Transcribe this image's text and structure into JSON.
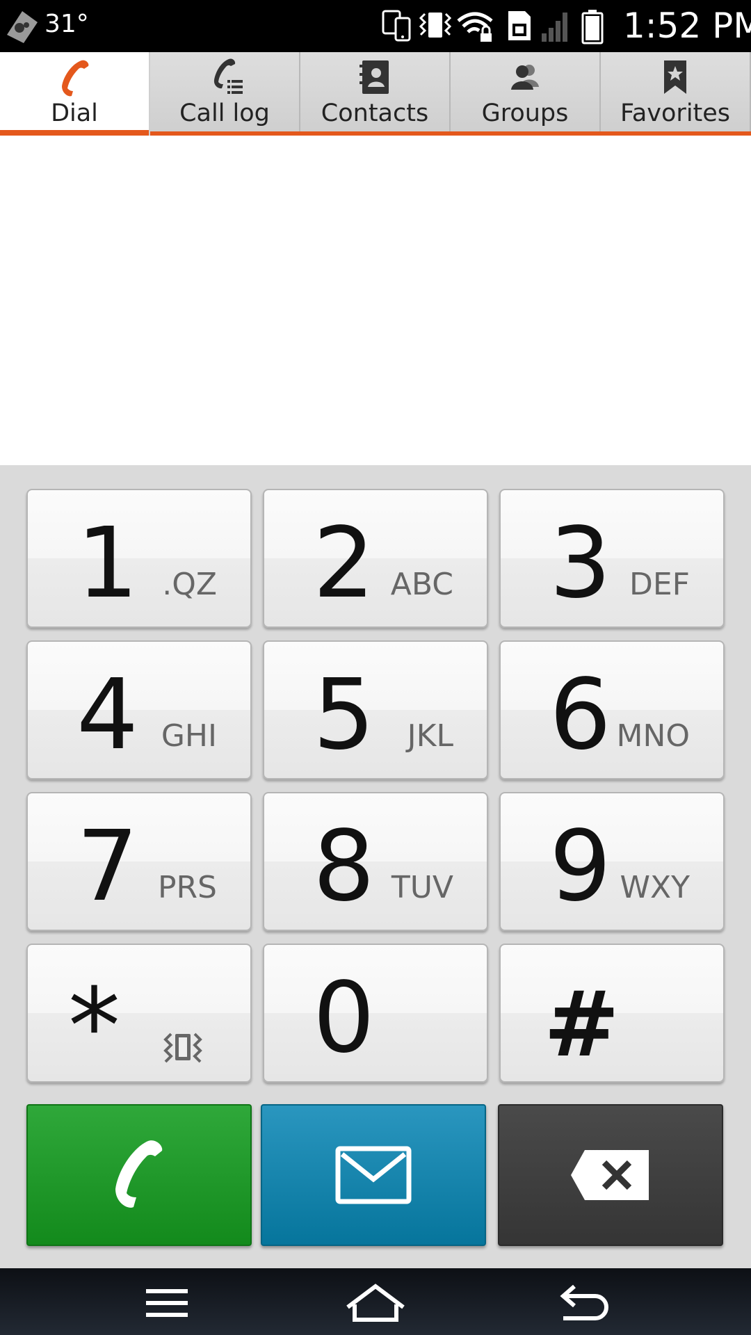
{
  "status_bar": {
    "temperature": "31°",
    "time": "1:52 PM",
    "icons": [
      "weather-icon",
      "phone-sync-icon",
      "vibrate-icon",
      "wifi-locked-icon",
      "sim-icon",
      "signal-icon",
      "battery-icon"
    ]
  },
  "tabs": [
    {
      "label": "Dial",
      "icon": "phone-icon",
      "active": true
    },
    {
      "label": "Call log",
      "icon": "call-log-icon",
      "active": false
    },
    {
      "label": "Contacts",
      "icon": "contacts-book-icon",
      "active": false
    },
    {
      "label": "Groups",
      "icon": "groups-icon",
      "active": false
    },
    {
      "label": "Favorites",
      "icon": "favorites-bookmark-icon",
      "active": false
    }
  ],
  "accent_color": "#e4581c",
  "keypad": {
    "keys": [
      {
        "digit": "1",
        "letters": ".QZ"
      },
      {
        "digit": "2",
        "letters": "ABC"
      },
      {
        "digit": "3",
        "letters": "DEF"
      },
      {
        "digit": "4",
        "letters": "GHI"
      },
      {
        "digit": "5",
        "letters": "JKL"
      },
      {
        "digit": "6",
        "letters": "MNO"
      },
      {
        "digit": "7",
        "letters": "PRS"
      },
      {
        "digit": "8",
        "letters": "TUV"
      },
      {
        "digit": "9",
        "letters": "WXY"
      },
      {
        "digit": "*",
        "icon": "vibrate-icon"
      },
      {
        "digit": "0",
        "letters": ""
      },
      {
        "digit": "#",
        "letters": ""
      }
    ]
  },
  "actions": {
    "call": {
      "icon": "phone-handset-icon",
      "color": "#1f9a2a"
    },
    "message": {
      "icon": "envelope-icon",
      "color": "#1586b0"
    },
    "delete": {
      "icon": "backspace-icon",
      "color": "#404040"
    }
  },
  "nav_bar": {
    "buttons": [
      "menu-icon",
      "home-icon",
      "back-icon"
    ]
  }
}
